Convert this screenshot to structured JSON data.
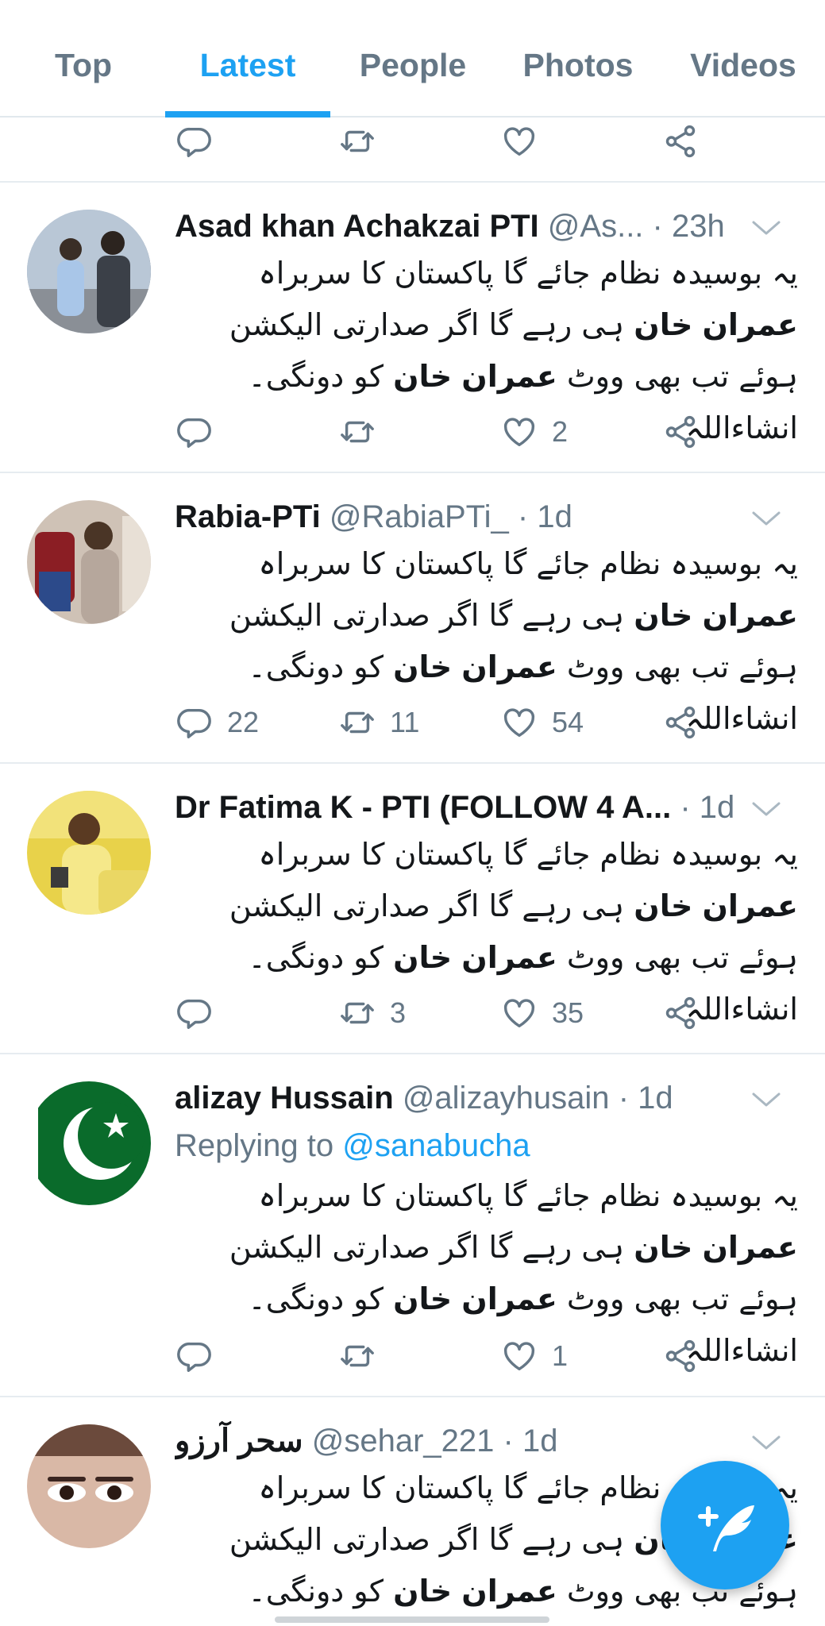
{
  "tabs": [
    {
      "label": "Top",
      "active": false
    },
    {
      "label": "Latest",
      "active": true
    },
    {
      "label": "People",
      "active": false
    },
    {
      "label": "Photos",
      "active": false
    },
    {
      "label": "Videos",
      "active": false
    }
  ],
  "tweets": [
    {
      "name": "Asad khan Achakzai PTI",
      "handle": "@As...",
      "time": "23h",
      "counts": {
        "reply": "",
        "retweet": "",
        "like": "2"
      }
    },
    {
      "name": "Rabia-PTi",
      "handle": "@RabiaPTi_",
      "time": "1d",
      "counts": {
        "reply": "22",
        "retweet": "11",
        "like": "54"
      }
    },
    {
      "name": "Dr Fatima K - PTI (FOLLOW 4 A...",
      "handle": "",
      "time": "1d",
      "counts": {
        "reply": "",
        "retweet": "3",
        "like": "35"
      }
    },
    {
      "name": "alizay Hussain",
      "handle": "@alizayhusain",
      "time": "1d",
      "reply_prefix": "Replying to",
      "reply_handle": "@sanabucha",
      "counts": {
        "reply": "",
        "retweet": "",
        "like": "1"
      }
    },
    {
      "name": "سحر آرزو",
      "handle": "@sehar_221",
      "time": "1d"
    }
  ],
  "text_segments": {
    "a": "یہ بوسیدہ نظام جائے گا پاکستان کا سربراہ ",
    "imran": "عمران",
    "khan": "خان",
    "b": " ہی رہے گا اگر صدارتی الیکشن ہوئے تب بھی ووٹ ",
    "c": " کو دونگی۔ انشاءاللہ"
  },
  "dot": "·",
  "colors": {
    "accent": "#1da1f2",
    "muted": "#657786",
    "divider": "#e6ecf0",
    "text": "#14171a"
  },
  "icons": {
    "reply": "reply-icon",
    "retweet": "retweet-icon",
    "like": "heart-icon",
    "share": "share-icon",
    "caret": "chevron-down-icon",
    "compose": "compose-tweet-icon"
  }
}
